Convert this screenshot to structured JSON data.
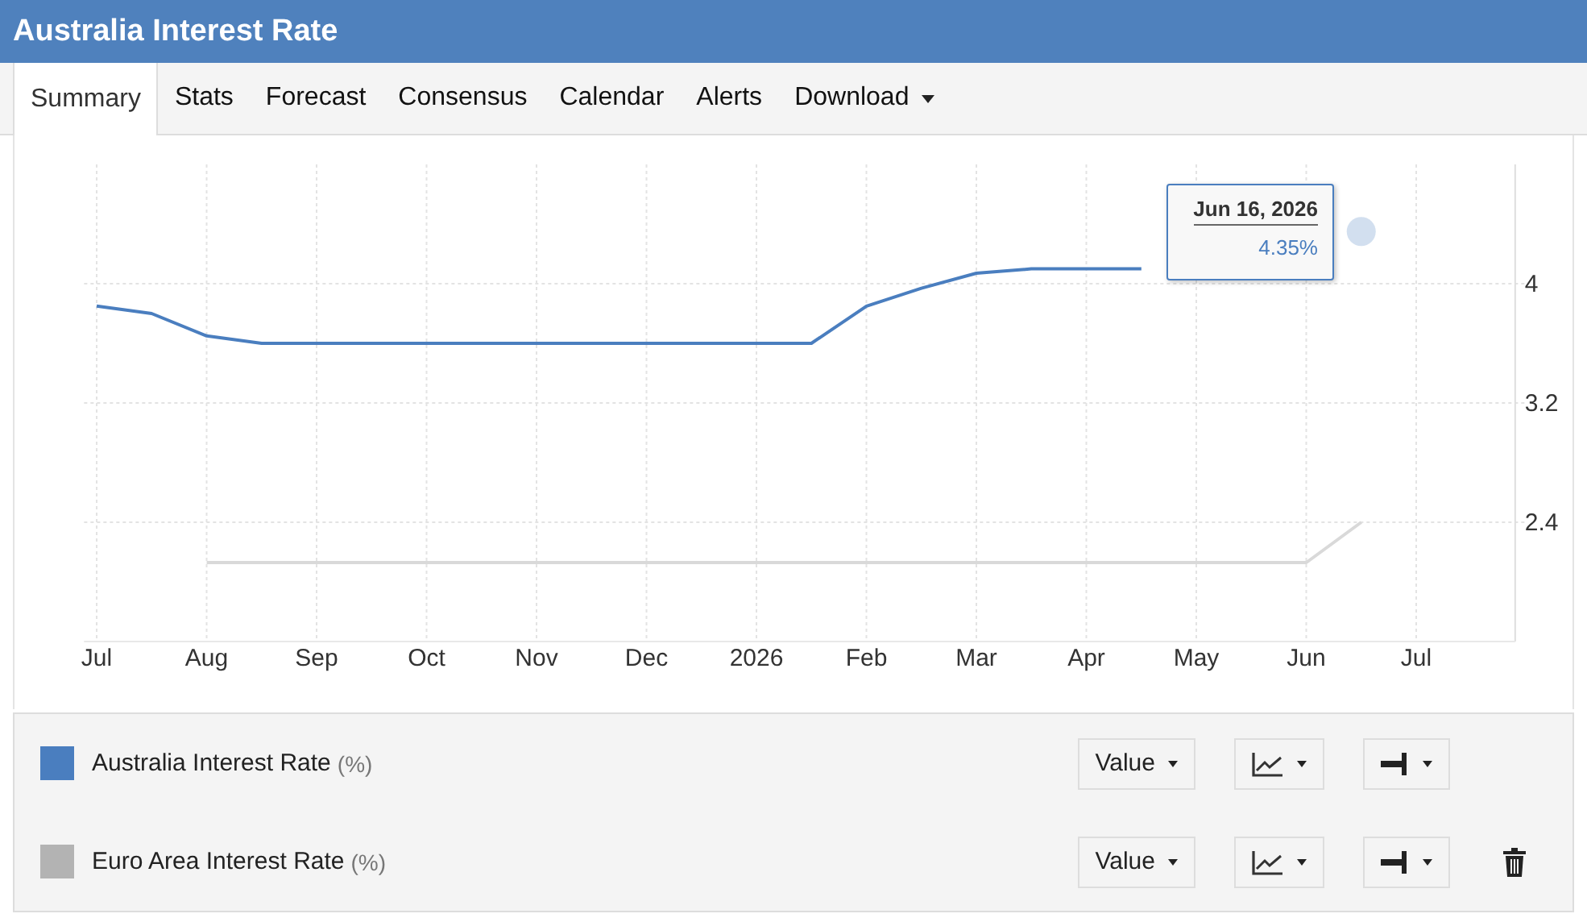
{
  "window": {
    "title": "Australia Interest Rate"
  },
  "tabs": [
    {
      "label": "Summary",
      "selected": true,
      "dropdown": false
    },
    {
      "label": "Stats",
      "selected": false,
      "dropdown": false
    },
    {
      "label": "Forecast",
      "selected": false,
      "dropdown": false
    },
    {
      "label": "Consensus",
      "selected": false,
      "dropdown": false
    },
    {
      "label": "Calendar",
      "selected": false,
      "dropdown": false
    },
    {
      "label": "Alerts",
      "selected": false,
      "dropdown": false
    },
    {
      "label": "Download",
      "selected": false,
      "dropdown": true
    }
  ],
  "chart": {
    "chart_data": {
      "type": "line",
      "categories": [
        "Jul",
        null,
        "Aug",
        null,
        "Sep",
        null,
        "Oct",
        null,
        "Nov",
        null,
        "Dec",
        null,
        "2026",
        null,
        "Feb",
        null,
        "Mar",
        null,
        "Apr",
        null,
        "May",
        null,
        "Jun",
        null,
        "Jul"
      ],
      "series": [
        {
          "name": "Australia Interest Rate",
          "color": "#4a7ebf",
          "values": [
            3.85,
            3.8,
            3.65,
            3.6,
            3.6,
            3.6,
            3.6,
            3.6,
            3.6,
            3.6,
            3.6,
            3.6,
            3.6,
            3.6,
            3.85,
            3.97,
            4.07,
            4.1,
            4.1,
            4.1,
            null,
            null,
            null,
            4.35,
            null
          ]
        },
        {
          "name": "Euro Area Interest Rate",
          "color": "#d9d9d9",
          "values": [
            null,
            null,
            2.13,
            2.13,
            2.13,
            2.13,
            2.13,
            2.13,
            2.13,
            2.13,
            2.13,
            2.13,
            2.13,
            2.13,
            2.13,
            2.13,
            2.13,
            2.13,
            2.13,
            2.13,
            2.13,
            2.13,
            2.13,
            2.4,
            null
          ]
        }
      ],
      "grid": true,
      "ylim": [
        1.6,
        4.8
      ],
      "yticks": [
        2.4,
        3.2,
        4
      ]
    },
    "tooltip": {
      "date": "Jun 16, 2026",
      "value": "4.35%"
    }
  },
  "legend": [
    {
      "unit": "(%)",
      "color": "#4a7ebf",
      "mode": "Value",
      "deletable": false
    },
    {
      "unit": "(%)",
      "color": "#b3b3b3",
      "mode": "Value",
      "deletable": true
    }
  ]
}
